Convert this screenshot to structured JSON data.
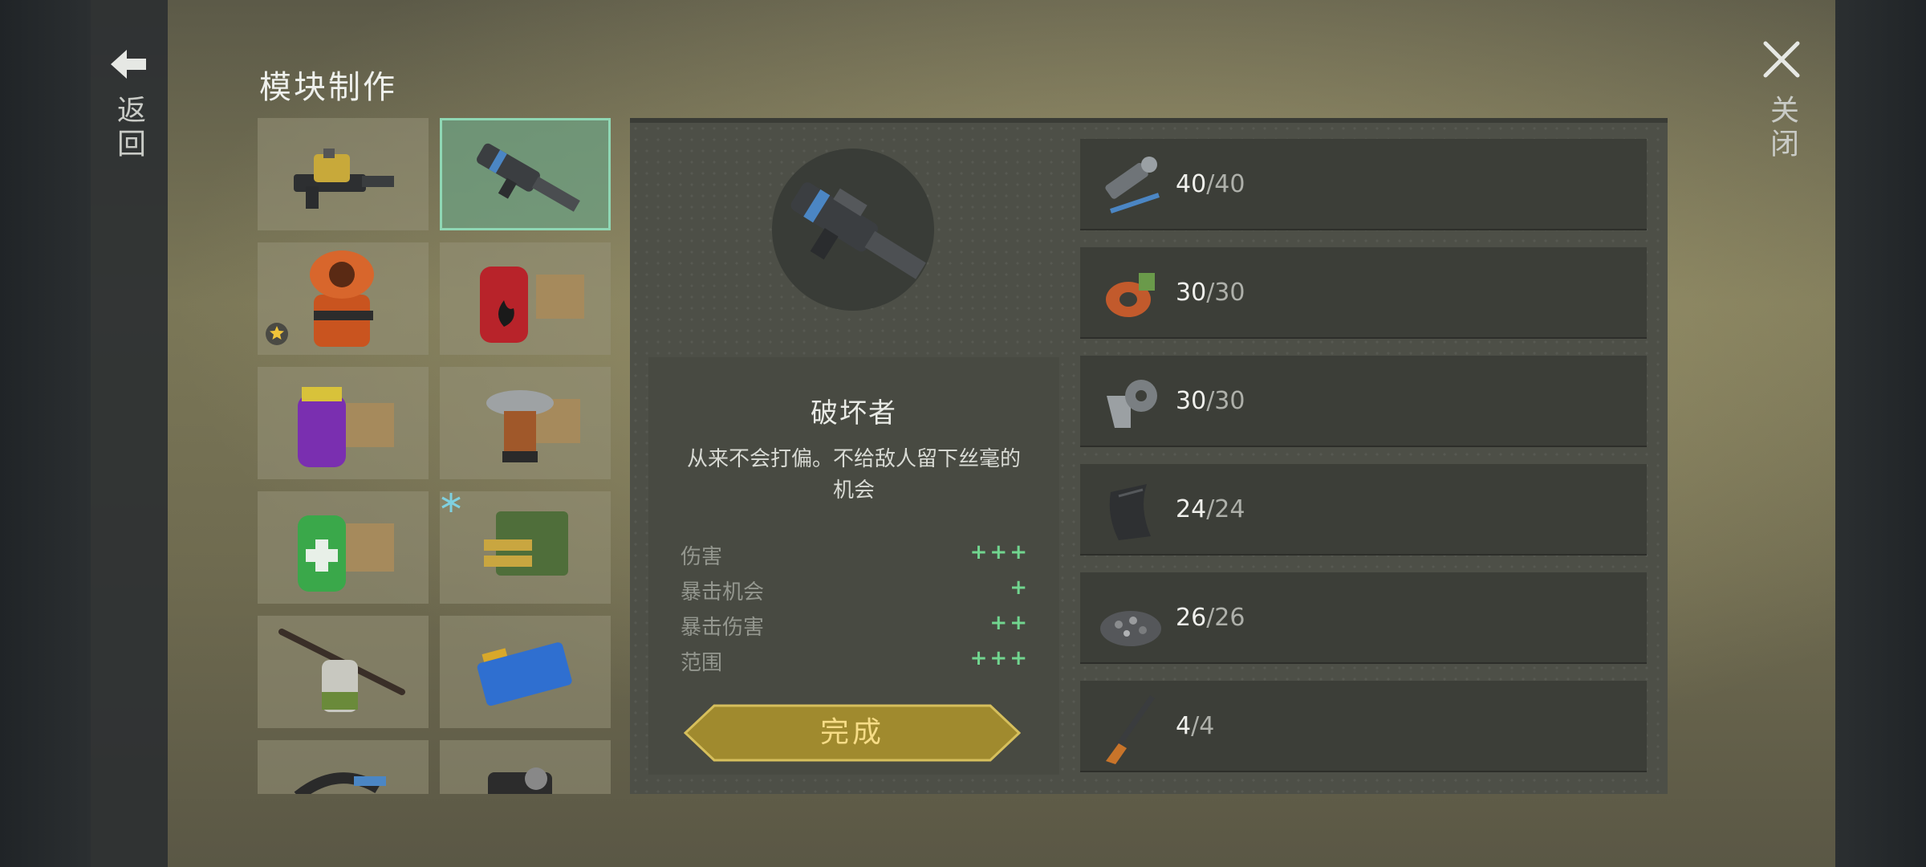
{
  "header": {
    "title": "模块制作"
  },
  "nav": {
    "back_label": "返回",
    "close_label": "关闭"
  },
  "grid": {
    "items": [
      {
        "name": "machine-gun-module"
      },
      {
        "name": "destroyer-module",
        "selected": true
      },
      {
        "name": "orange-engine-module",
        "badge": "star"
      },
      {
        "name": "fire-canister-module"
      },
      {
        "name": "purple-canister-module"
      },
      {
        "name": "tesla-coil-module"
      },
      {
        "name": "medkit-canister-module"
      },
      {
        "name": "ammo-box-module",
        "badge": "snowflake"
      },
      {
        "name": "propeller-motor-module"
      },
      {
        "name": "battery-module"
      },
      {
        "name": "wire-module"
      },
      {
        "name": "mechanism-module"
      }
    ]
  },
  "detail": {
    "name": "破坏者",
    "description": "从来不会打偏。不给敌人留下丝毫的机会",
    "stats": [
      {
        "label": "伤害",
        "value": "+++"
      },
      {
        "label": "暴击机会",
        "value": "+"
      },
      {
        "label": "暴击伤害",
        "value": "++"
      },
      {
        "label": "范围",
        "value": "+++"
      }
    ],
    "complete_label": "完成"
  },
  "materials": [
    {
      "icon": "gun-parts-icon",
      "have": "40",
      "need": "/40"
    },
    {
      "icon": "copper-coil-icon",
      "have": "30",
      "need": "/30"
    },
    {
      "icon": "gear-bracket-icon",
      "have": "30",
      "need": "/30"
    },
    {
      "icon": "metal-sheet-icon",
      "have": "24",
      "need": "/24"
    },
    {
      "icon": "gravel-pile-icon",
      "have": "26",
      "need": "/26"
    },
    {
      "icon": "rifle-icon",
      "have": "4",
      "need": "/4"
    }
  ],
  "colors": {
    "selected_border": "#8fd7b4",
    "stat_plus": "#71d58f",
    "button_gold": "#a08a2e"
  }
}
